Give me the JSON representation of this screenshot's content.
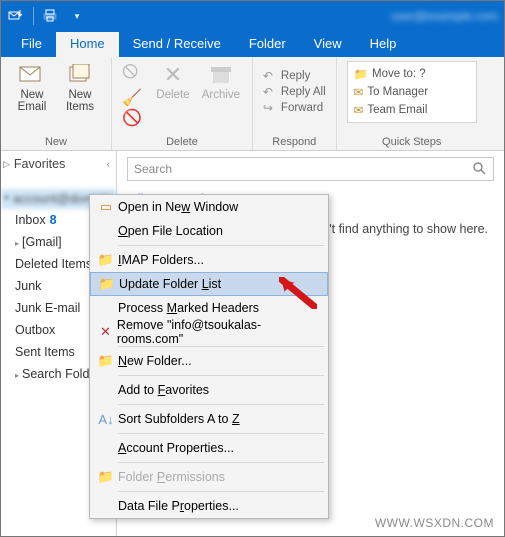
{
  "titlebar": {
    "account_blur": "user@example.com"
  },
  "tabs": {
    "file": "File",
    "home": "Home",
    "sendreceive": "Send / Receive",
    "folder": "Folder",
    "view": "View",
    "help": "Help"
  },
  "ribbon": {
    "new": {
      "email": "New\nEmail",
      "items": "New\nItems",
      "group": "New"
    },
    "delete": {
      "delete": "Delete",
      "archive": "Archive",
      "group": "Delete"
    },
    "respond": {
      "reply": "Reply",
      "replyall": "Reply All",
      "forward": "Forward",
      "group": "Respond"
    },
    "quicksteps": {
      "moveto": "Move to: ?",
      "tomanager": "To Manager",
      "teamemail": "Team Email",
      "group": "Quick Steps"
    }
  },
  "nav": {
    "favorites": "Favorites",
    "account_blur": "account@domain",
    "folders": {
      "inbox": "Inbox",
      "inbox_count": "8",
      "gmail": "[Gmail]",
      "deleted": "Deleted Items",
      "junk": "Junk",
      "junke": "Junk E-mail",
      "outbox": "Outbox",
      "sent": "Sent Items",
      "search": "Search Folders"
    }
  },
  "reading": {
    "search_placeholder": "Search",
    "filter_all": "All",
    "filter_unread": "Unread",
    "empty_msg": "We didn't find anything to show here."
  },
  "ctx": {
    "open_new_window": "Open in New Window",
    "open_file_loc": "Open File Location",
    "imap_folders": "IMAP Folders...",
    "update_folder_list": "Update Folder List",
    "process_marked": "Process Marked Headers",
    "remove": "Remove \"info@tsoukalas-rooms.com\"",
    "new_folder": "New Folder...",
    "add_fav": "Add to Favorites",
    "sort_az": "Sort Subfolders A to Z",
    "acct_props": "Account Properties...",
    "folder_perm": "Folder Permissions",
    "datafile_props": "Data File Properties..."
  },
  "watermark": "WWW.WSXDN.COM"
}
